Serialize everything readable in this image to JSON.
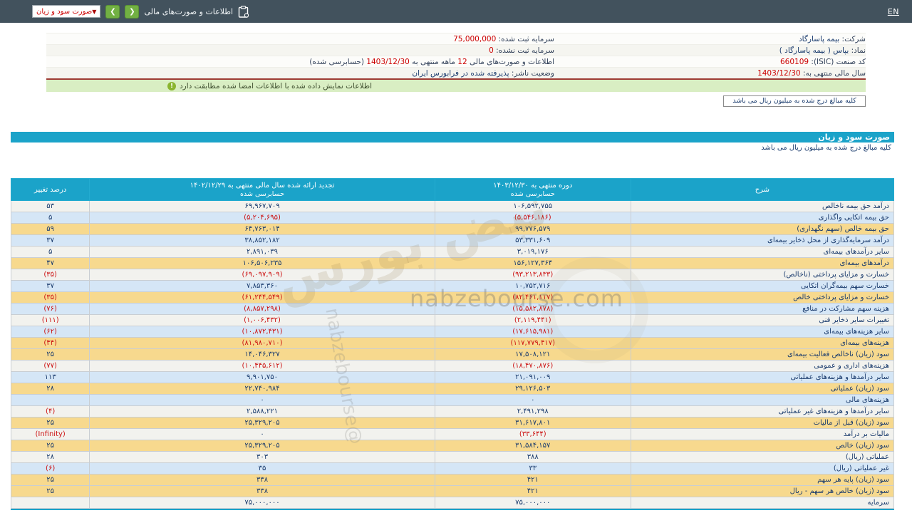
{
  "topbar": {
    "en_link": "EN",
    "title": "اطلاعات و صورت‌های مالی",
    "dropdown_value": "صورت سود و زیان",
    "nav_back": "❮",
    "nav_forward": "❯"
  },
  "company": {
    "name_label": "شرکت:",
    "name": "بیمه پاسارگاد",
    "symbol_label": "نماد:",
    "symbol": "بپاس ( بیمه پاسارگاد )",
    "isic_label": "کد صنعت (ISIC):",
    "isic": "660109",
    "fiscal_label": "سال مالی منتهی به:",
    "fiscal": "1403/12/30",
    "capital_reg_label": "سرمایه ثبت شده:",
    "capital_reg": "75,000,000",
    "capital_unreg_label": "سرمایه ثبت نشده:",
    "capital_unreg": "0",
    "period_part1": "اطلاعات و صورت‌های مالی",
    "period_months": "12",
    "period_part2": "ماهه منتهی به",
    "period_date": "1403/12/30",
    "period_part3": "(حسابرسی شده)",
    "status_label": "وضعیت ناشر:",
    "status": "پذیرفته شده در فرابورس ایران"
  },
  "alert": {
    "icon": "!",
    "text": "اطلاعات نمایش داده شده با اطلاعات امضا شده مطابقت دارد"
  },
  "notes": {
    "amounts_note": "کلیه مبالغ درج شده به میلیون ریال می باشد"
  },
  "section": {
    "title": "صورت سود و زیان"
  },
  "table": {
    "header": {
      "desc": "شرح",
      "cur1": "دوره منتهی به ۱۴۰۳/۱۲/۳۰",
      "cur2": "حسابرسی شده",
      "prior1": "تجدید ارائه شده سال مالی منتهی به ۱۴۰۲/۱۲/۲۹",
      "prior2": "حسابرسی شده",
      "pct": "درصد تغییر"
    },
    "rows": [
      {
        "label": "درآمد حق بیمه ناخالص",
        "cur": "۱۰۶,۵۹۲,۷۵۵",
        "prior": "۶۹,۹۶۷,۷۰۹",
        "pct": "۵۳",
        "bg": "w"
      },
      {
        "label": "حق بیمه اتکایی واگذاری",
        "cur": "(۵,۵۴۶,۱۸۶)",
        "prior": "(۵,۲۰۴,۶۹۵)",
        "pct": "۵",
        "bg": "b"
      },
      {
        "label": "حق بیمه خالص (سهم نگهداری)",
        "cur": "۹۹,۷۷۶,۵۷۹",
        "prior": "۶۴,۷۶۳,۰۱۴",
        "pct": "۵۹",
        "bg": "o"
      },
      {
        "label": "درآمد سرمایه‌گذاری از محل ذخایر بیمه‌ای",
        "cur": "۵۳,۳۳۱,۶۰۹",
        "prior": "۳۸,۸۵۲,۱۸۲",
        "pct": "۳۷",
        "bg": "b"
      },
      {
        "label": "سایر درآمدهای بیمه‌ای",
        "cur": "۳,۰۱۹,۱۷۶",
        "prior": "۲,۸۹۱,۰۳۹",
        "pct": "۵",
        "bg": "w"
      },
      {
        "label": "درآمدهای بیمه‌ای",
        "cur": "۱۵۶,۱۲۷,۳۶۴",
        "prior": "۱۰۶,۵۰۶,۲۳۵",
        "pct": "۴۷",
        "bg": "o"
      },
      {
        "label": "خسارت و مزایای پرداختی (ناخالص)",
        "cur": "(۹۳,۲۱۳,۸۳۳)",
        "prior": "(۶۹,۰۹۷,۹۰۹)",
        "pct": "(۳۵)",
        "bg": "w"
      },
      {
        "label": "خسارت سهم بیمه‌گران اتکایی",
        "cur": "۱۰,۷۵۲,۷۱۶",
        "prior": "۷,۸۵۳,۳۶۰",
        "pct": "۳۷",
        "bg": "b"
      },
      {
        "label": "خسارت و مزایای پرداختی خالص",
        "cur": "(۸۲,۴۶۱,۱۱۷)",
        "prior": "(۶۱,۲۴۴,۵۴۹)",
        "pct": "(۳۵)",
        "bg": "o"
      },
      {
        "label": "هزینه سهم مشارکت در منافع",
        "cur": "(۱۵,۵۸۲,۸۷۸)",
        "prior": "(۸,۸۵۷,۲۹۸)",
        "pct": "(۷۶)",
        "bg": "b"
      },
      {
        "label": "تغییرات سایر ذخایر فنی",
        "cur": "(۲,۱۱۹,۴۴۱)",
        "prior": "(۱,۰۰۶,۴۳۲)",
        "pct": "(۱۱۱)",
        "bg": "w"
      },
      {
        "label": "سایر هزینه‌های بیمه‌ای",
        "cur": "(۱۷,۶۱۵,۹۸۱)",
        "prior": "(۱۰,۸۷۲,۴۳۱)",
        "pct": "(۶۲)",
        "bg": "b"
      },
      {
        "label": "هزینه‌های بیمه‌ای",
        "cur": "(۱۱۷,۷۷۹,۴۱۷)",
        "prior": "(۸۱,۹۸۰,۷۱۰)",
        "pct": "(۴۴)",
        "bg": "o"
      },
      {
        "label": "سود (زیان) ناخالص فعالیت بیمه‌ای",
        "cur": "۱۷,۵۰۸,۱۲۱",
        "prior": "۱۴,۰۴۶,۳۲۷",
        "pct": "۲۵",
        "bg": "o"
      },
      {
        "label": "هزینه‌های اداری و عمومی",
        "cur": "(۱۸,۴۷۰,۸۷۶)",
        "prior": "(۱۰,۴۴۵,۶۱۲)",
        "pct": "(۷۷)",
        "bg": "w"
      },
      {
        "label": "سایر درآمدها و هزینه‌های عملیاتی",
        "cur": "۲۱,۰۹۱,۰۰۹",
        "prior": "۹,۹۰۱,۷۵۰",
        "pct": "۱۱۳",
        "bg": "b"
      },
      {
        "label": "سود (زیان) عملیاتی",
        "cur": "۲۹,۱۲۶,۵۰۳",
        "prior": "۲۲,۷۴۰,۹۸۴",
        "pct": "۲۸",
        "bg": "o"
      },
      {
        "label": "هزینه‌های مالی",
        "cur": "۰",
        "prior": "۰",
        "pct": "",
        "bg": "b"
      },
      {
        "label": "سایر درآمدها و هزینه‌های غیر عملیاتی",
        "cur": "۲,۴۹۱,۲۹۸",
        "prior": "۲,۵۸۸,۲۲۱",
        "pct": "(۴)",
        "bg": "w"
      },
      {
        "label": "سود (زیان) قبل از مالیات",
        "cur": "۳۱,۶۱۷,۸۰۱",
        "prior": "۲۵,۳۲۹,۲۰۵",
        "pct": "۲۵",
        "bg": "o"
      },
      {
        "label": "مالیات بر درآمد",
        "cur": "(۳۳,۶۴۴)",
        "prior": "۰",
        "pct": "(Infinity)",
        "bg": "w"
      },
      {
        "label": "سود (زیان) خالص",
        "cur": "۳۱,۵۸۴,۱۵۷",
        "prior": "۲۵,۳۲۹,۲۰۵",
        "pct": "۲۵",
        "bg": "o"
      },
      {
        "label": "عملیاتی (ریال)",
        "cur": "۳۸۸",
        "prior": "۳۰۳",
        "pct": "۲۸",
        "bg": "w"
      },
      {
        "label": "غیر عملیاتی (ریال)",
        "cur": "۳۳",
        "prior": "۳۵",
        "pct": "(۶)",
        "bg": "b"
      },
      {
        "label": "سود (زیان) پایه هر سهم",
        "cur": "۴۲۱",
        "prior": "۳۳۸",
        "pct": "۲۵",
        "bg": "o"
      },
      {
        "label": "سود (زیان) خالص هر سهم - ریال",
        "cur": "۴۲۱",
        "prior": "۳۳۸",
        "pct": "۲۵",
        "bg": "o"
      },
      {
        "label": "سرمایه",
        "cur": "۷۵,۰۰۰,۰۰۰",
        "prior": "۷۵,۰۰۰,۰۰۰",
        "pct": "",
        "bg": "w"
      }
    ]
  },
  "watermark": {
    "fa": "نبض بورس",
    "site": "nabzebourse.com",
    "handle": "@nabzebourse"
  },
  "colors": {
    "accent_teal": "#1BA3C9",
    "topbar_bg": "#42525D",
    "alert_green_bg": "#D9EEC3",
    "row_highlight": "#F7D98E",
    "row_blue": "#D5E6F6",
    "negative_red": "#CC1111",
    "value_navy": "#1B3C6E",
    "nav_button_green": "#72B043"
  }
}
